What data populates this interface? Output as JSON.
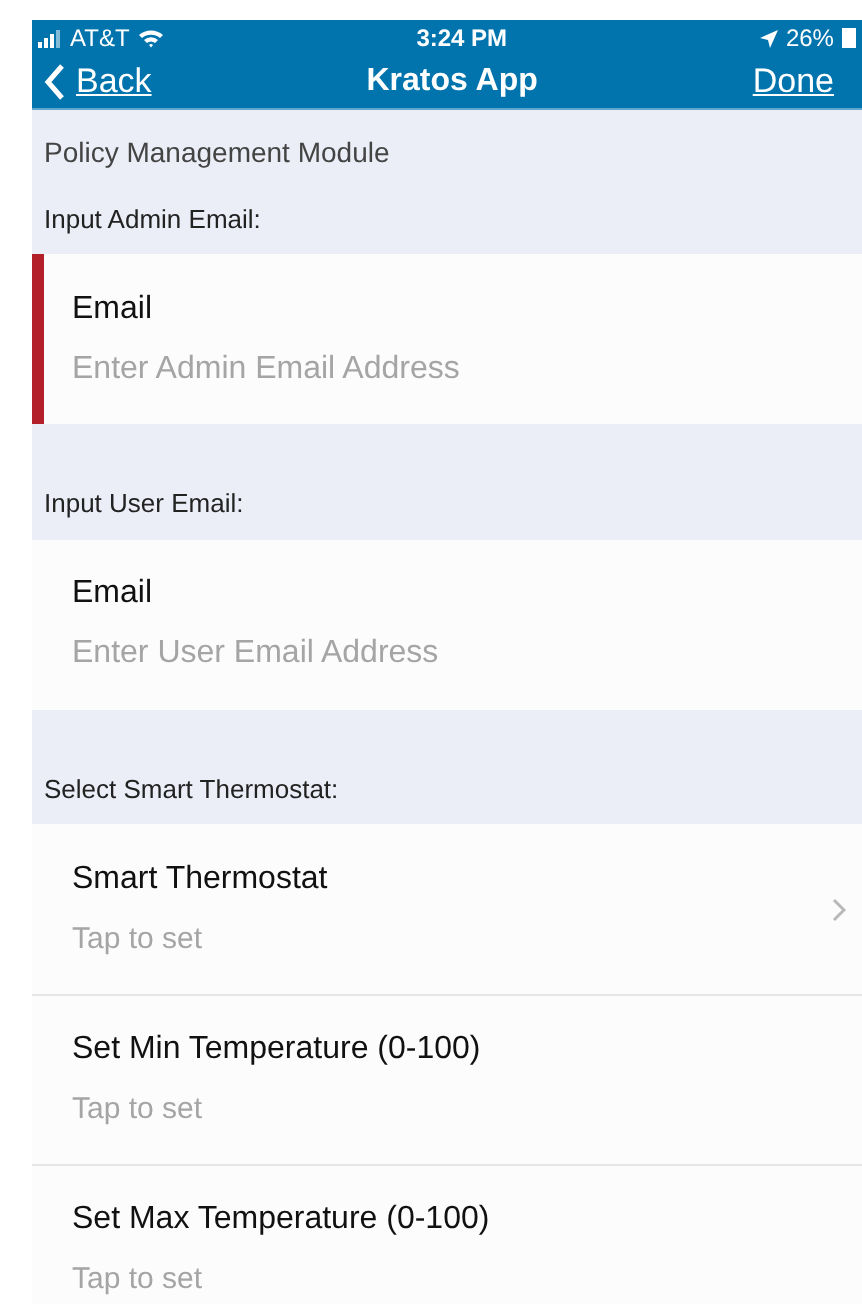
{
  "status_bar": {
    "carrier": "AT&T",
    "time": "3:24 PM",
    "battery": "26%"
  },
  "nav": {
    "back": "Back",
    "title": "Kratos App",
    "done": "Done"
  },
  "module_title": "Policy Management Module",
  "sections": [
    {
      "header": "Input Admin Email:",
      "rows": [
        {
          "kind": "field",
          "label": "Email",
          "placeholder": "Enter Admin Email Address",
          "invalid": true
        }
      ]
    },
    {
      "header": "Input User Email:",
      "rows": [
        {
          "kind": "field",
          "label": "Email",
          "placeholder": "Enter User Email Address",
          "invalid": false
        }
      ]
    },
    {
      "header": "Select Smart Thermostat:",
      "rows": [
        {
          "kind": "picker",
          "label": "Smart Thermostat",
          "value": "Tap to set",
          "disclosure": true
        },
        {
          "kind": "picker",
          "label": "Set Min Temperature (0-100)",
          "value": "Tap to set",
          "disclosure": false
        },
        {
          "kind": "picker",
          "label": "Set Max Temperature (0-100)",
          "value": "Tap to set",
          "disclosure": false
        }
      ]
    }
  ]
}
